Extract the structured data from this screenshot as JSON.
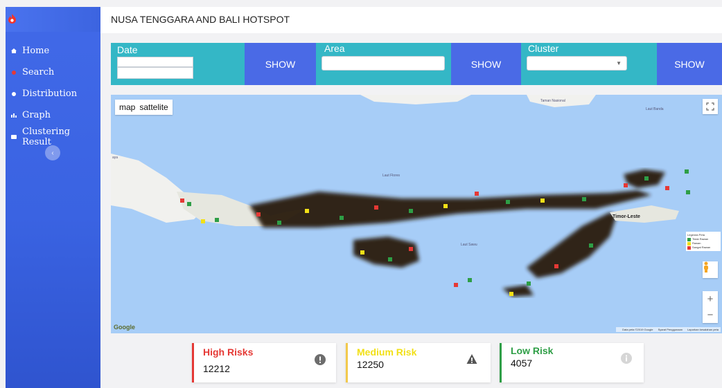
{
  "header": {
    "title": "NUSA TENGGARA AND BALI HOTSPOT"
  },
  "sidebar": {
    "items": [
      {
        "label": "Home",
        "icon": "home-icon"
      },
      {
        "label": "Search",
        "icon": "search-pin-icon"
      },
      {
        "label": "Distribution",
        "icon": "circle-icon"
      },
      {
        "label": "Graph",
        "icon": "bar-chart-icon"
      },
      {
        "label": "Clustering Result",
        "icon": "card-icon"
      }
    ],
    "collapse_glyph": "‹"
  },
  "filters": {
    "date": {
      "label": "Date",
      "value_1": "",
      "value_2": ""
    },
    "date_button": "SHOW",
    "area": {
      "label": "Area",
      "value": ""
    },
    "area_button": "SHOW",
    "cluster": {
      "label": "Cluster",
      "selected": ""
    },
    "cluster_button": "SHOW"
  },
  "map": {
    "type_options": [
      "map",
      "sattelite"
    ],
    "labels": {
      "timor_leste": "Timor-Leste",
      "jaya": "aya",
      "sea_name": "Laut Flores",
      "savu_sea": "Laut Sawu",
      "park": "Taman Nasional",
      "banda": "Laut Banda"
    },
    "legend": {
      "title": "Legenda Peta",
      "items": [
        "Tidak Rawan",
        "Rawan",
        "Sangat Rawan"
      ]
    },
    "google": "Google",
    "footer": [
      "Data peta ©2019 Google",
      "Syarat Penggunaan",
      "Laporkan kesalahan peta"
    ],
    "colors": {
      "water": "#a7cdf7",
      "land": "#f1f1ee",
      "hotspot": "#2c1d10"
    }
  },
  "stats": [
    {
      "title": "High Risks",
      "value": "12212",
      "color": "#e53935",
      "icon": "exclamation-circle-icon"
    },
    {
      "title": "Medium Risk",
      "value": "12250",
      "color": "#f2e017",
      "icon": "warning-triangle-icon"
    },
    {
      "title": "Low Risk",
      "value": "4057",
      "color": "#2e9e46",
      "icon": "info-circle-icon"
    }
  ]
}
